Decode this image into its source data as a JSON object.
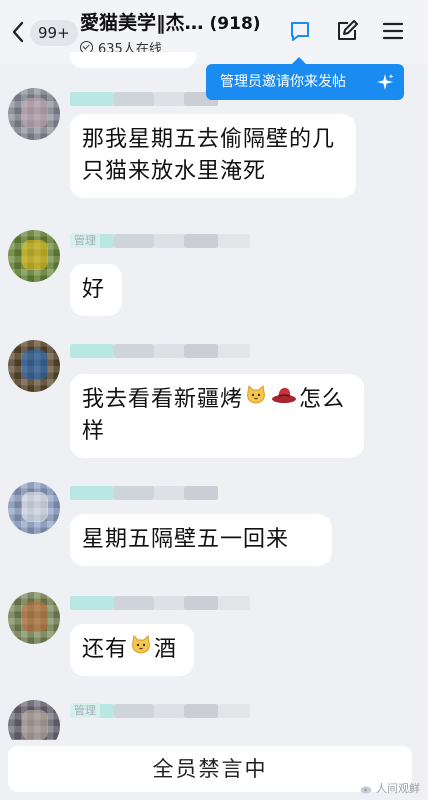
{
  "header": {
    "unread_count": "99+",
    "group_name": "愛猫美学‖杰…",
    "member_count": "(918)",
    "online_text": "635人在线"
  },
  "tooltip": {
    "text": "管理员邀请你来发帖"
  },
  "messages": [
    {
      "text": "那我星期五去偷隔壁的几只猫来放水里淹死",
      "admin_tag": ""
    },
    {
      "text": "好",
      "admin_tag": "管理"
    },
    {
      "text_before": "我去看看新疆烤",
      "text_after": "怎么样",
      "emoji": [
        "cat-face",
        "hat"
      ]
    },
    {
      "text": "星期五隔壁五一回来"
    },
    {
      "text_before": "还有",
      "text_after": "酒",
      "emoji": [
        "cat-face"
      ]
    },
    {
      "admin_tag": "管理"
    }
  ],
  "footer": {
    "muted_text": "全员禁言中",
    "watermark": "人间观鲜"
  },
  "colors": {
    "accent": "#1a8bf0",
    "background": "#eef0f4",
    "bubble": "#ffffff"
  }
}
